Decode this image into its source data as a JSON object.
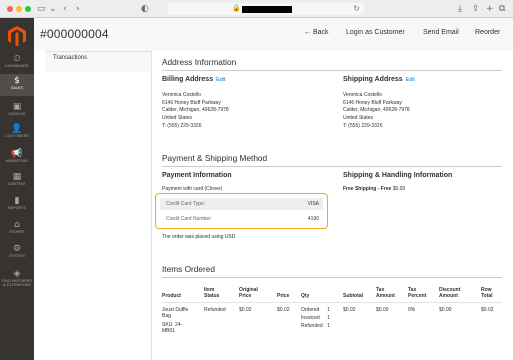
{
  "browser": {
    "tabs_icon": "sidebar-toggle-icon",
    "url_redacted": true
  },
  "sidebar": {
    "items": [
      {
        "label": "Dashboard",
        "icon": "speedometer-icon",
        "glyph": "⏲"
      },
      {
        "label": "Sales",
        "icon": "dollar-icon",
        "glyph": "$"
      },
      {
        "label": "Catalog",
        "icon": "cube-icon",
        "glyph": "▣"
      },
      {
        "label": "Customers",
        "icon": "person-icon",
        "glyph": "👤"
      },
      {
        "label": "Marketing",
        "icon": "megaphone-icon",
        "glyph": "📢"
      },
      {
        "label": "Content",
        "icon": "layout-icon",
        "glyph": "▦"
      },
      {
        "label": "Reports",
        "icon": "bar-chart-icon",
        "glyph": "▮"
      },
      {
        "label": "Stores",
        "icon": "store-icon",
        "glyph": "⌂"
      },
      {
        "label": "System",
        "icon": "gear-icon",
        "glyph": "⚙"
      },
      {
        "label": "Find Partners & Extensions",
        "icon": "blocks-icon",
        "glyph": "◈"
      }
    ]
  },
  "header": {
    "title": "#000000004",
    "back": "Back",
    "login_as_customer": "Login as Customer",
    "send_email": "Send Email",
    "reorder": "Reorder"
  },
  "tabs": {
    "transactions": "Transactions"
  },
  "address_info": {
    "title": "Address Information",
    "edit": "Edit",
    "billing": {
      "title": "Billing Address",
      "lines": [
        "Veronica Costello",
        "6146 Honey Bluff Parkway",
        "Calder, Michigan, 49628-7978",
        "United States",
        "T: (555) 229-3326"
      ]
    },
    "shipping": {
      "title": "Shipping Address",
      "lines": [
        "Veronica Costello",
        "6146 Honey Bluff Parkway",
        "Calder, Michigan, 49628-7978",
        "United States",
        "T: (555) 229-3326"
      ]
    }
  },
  "payment_shipping": {
    "title": "Payment & Shipping Method",
    "payment_title": "Payment Information",
    "payment_method": "Payment with card (Clover)",
    "card_type_label": "Credit Card Type:",
    "card_type_value": "VISA",
    "card_number_label": "Credit Card Number:",
    "card_number_value": "4190",
    "currency_note": "The order was placed using USD.",
    "shipping_title": "Shipping & Handling Information",
    "shipping_method": "Free Shipping - Free",
    "shipping_price": "$0.00"
  },
  "items_ordered": {
    "title": "Items Ordered",
    "headers": {
      "product": "Product",
      "item_status_1": "Item",
      "item_status_2": "Status",
      "original_price_1": "Original",
      "original_price_2": "Price",
      "price": "Price",
      "qty": "Qty",
      "subtotal": "Subtotal",
      "tax_amount_1": "Tax",
      "tax_amount_2": "Amount",
      "tax_percent_1": "Tax",
      "tax_percent_2": "Percent",
      "discount_1": "Discount",
      "discount_2": "Amount",
      "row_total_1": "Row",
      "row_total_2": "Total"
    },
    "row": {
      "product_1": "Joust Duffle",
      "product_2": "Bag",
      "sku_1": "SKU: 24-",
      "sku_2": "MB01",
      "status": "Refunded",
      "original_price": "$0.02",
      "price": "$0.02",
      "qty_ordered": "Ordered",
      "qty_ordered_n": "1",
      "qty_invoiced": "Invoiced",
      "qty_invoiced_n": "1",
      "qty_refunded": "Refunded",
      "qty_refunded_n": "1",
      "subtotal": "$0.02",
      "tax_amount": "$0.00",
      "tax_percent": "0%",
      "discount": "$0.00",
      "row_total": "$0.02"
    }
  },
  "colors": {
    "sidebar_bg": "#373330",
    "sidebar_active": "#524d49",
    "link": "#007bdb",
    "highlight": "#f5a623",
    "logo": "#eb5202"
  }
}
